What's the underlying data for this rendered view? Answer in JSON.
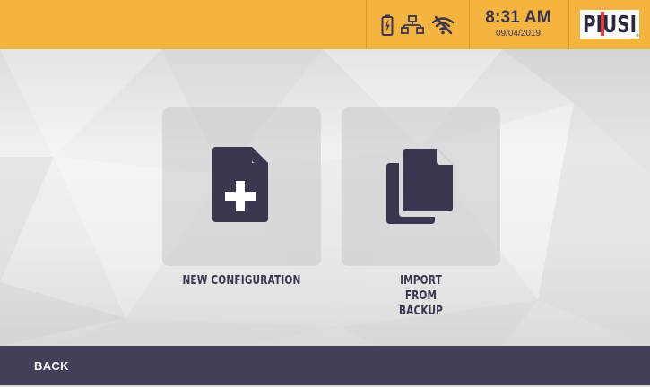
{
  "header": {
    "time": "8:31 AM",
    "date": "09/04/2019",
    "logo_text": "PIUSI",
    "icons": [
      "battery-charging-icon",
      "network-icon",
      "wifi-off-icon"
    ]
  },
  "tiles": [
    {
      "label": "NEW CONFIGURATION",
      "icon": "new-document-icon"
    },
    {
      "label": "IMPORT FROM BACKUP",
      "icon": "copy-documents-icon"
    }
  ],
  "footer": {
    "back_label": "BACK"
  },
  "colors": {
    "header_bg": "#f5b33f",
    "footer_bg": "#433f58",
    "icon_dark": "#3a3650",
    "logo_red": "#d62027"
  }
}
